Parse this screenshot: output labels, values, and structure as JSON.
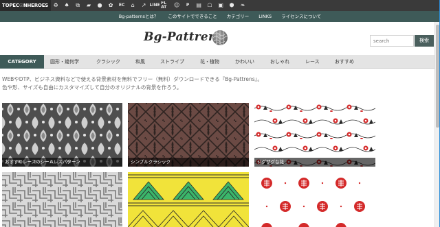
{
  "iconbar": {
    "brand": "TOPEC☉NHEROES",
    "icons": [
      {
        "name": "recycle-icon",
        "glyph": "♻"
      },
      {
        "name": "person-icon",
        "glyph": "♠"
      },
      {
        "name": "copy-icon",
        "glyph": "⧉"
      },
      {
        "name": "shirt-icon",
        "glyph": "▰"
      },
      {
        "name": "speech-bubble-icon",
        "glyph": "●"
      },
      {
        "name": "flower-icon",
        "glyph": "✿"
      },
      {
        "name": "ec-icon",
        "glyph": "EC",
        "text": true
      },
      {
        "name": "home-icon",
        "glyph": "⌂"
      },
      {
        "name": "arrows-icon",
        "glyph": "↗"
      },
      {
        "name": "line-icon",
        "glyph": "LINE",
        "text": true
      },
      {
        "name": "flat-icon",
        "glyph": "FL AT",
        "text": true
      },
      {
        "name": "smile-icon",
        "glyph": "☺"
      },
      {
        "name": "parking-icon",
        "glyph": "P",
        "text": true
      },
      {
        "name": "box-icon",
        "glyph": "▤"
      },
      {
        "name": "building-icon",
        "glyph": "☖"
      },
      {
        "name": "bus-icon",
        "glyph": "▣"
      },
      {
        "name": "hexagon-icon",
        "glyph": "⬢"
      },
      {
        "name": "bird-icon",
        "glyph": "❧"
      }
    ]
  },
  "topnav": {
    "items": [
      "Bg-patternsとは？",
      "このサイトでできること",
      "カテゴリー",
      "LINKS",
      "ライセンスについて"
    ]
  },
  "header": {
    "logo_text": "Bg-Pattrens",
    "search_placeholder": "search",
    "search_button": "検索"
  },
  "categories": [
    "CATEGORY",
    "図形・幾何学",
    "クラシック",
    "和風",
    "ストライプ",
    "花・植物",
    "かわいい",
    "おしゃれ",
    "レース",
    "おすすめ"
  ],
  "intro": {
    "line1": "WEBやDTP、ビジネス資料などで使える背景素材を無料でフリー（無料）ダウンロードできる『Bg-Pattrens』。",
    "line2": "色や形、サイズも自由にカスタマイズして自分のオリジナルの背景を作ろう。"
  },
  "gallery": [
    {
      "caption": "おすすめレースのシームレスパターン",
      "theme": "lace-gray"
    },
    {
      "caption": "シンプルクラシック",
      "theme": "classic-brown"
    },
    {
      "caption": "ジグザグな花",
      "theme": "zigzag-flowers"
    },
    {
      "caption": "",
      "theme": "geometric-gray"
    },
    {
      "caption": "",
      "theme": "yellow-triangles"
    },
    {
      "caption": "",
      "theme": "red-circles"
    }
  ],
  "colors": {
    "topnav": "#3e5a58",
    "iconbar": "#3a3a3a",
    "classic": "#6b4a44",
    "lace": "#4e4e4e",
    "flower_red": "#d42a2a",
    "yellow": "#f1e33a",
    "green": "#3bb56a"
  }
}
